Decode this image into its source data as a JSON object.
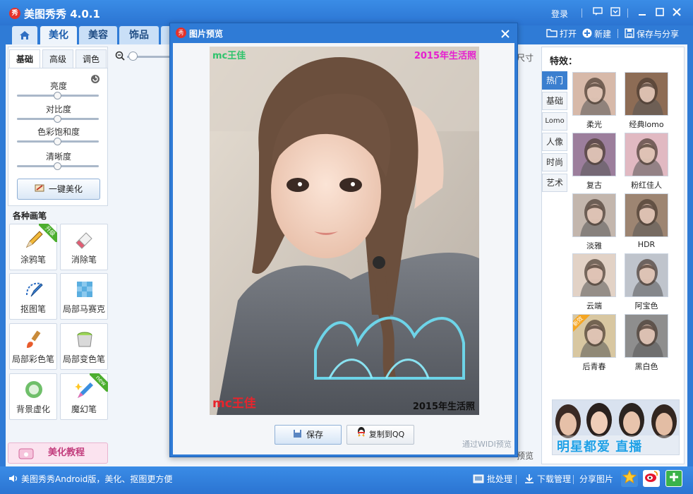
{
  "app": {
    "title": "美图秀秀 4.0.1",
    "logo_char": "秀",
    "login": "登录",
    "window_controls": [
      "chat-icon",
      "skin-icon",
      "minimize-icon",
      "maximize-icon",
      "close-icon"
    ]
  },
  "tabs": [
    {
      "label": "美化",
      "active": true
    },
    {
      "label": "美容",
      "active": false
    },
    {
      "label": "饰品",
      "active": false
    }
  ],
  "top_actions": {
    "open": "打开",
    "new": "新建",
    "save_share": "保存与分享"
  },
  "left_panel": {
    "subtabs": [
      "基础",
      "高级",
      "调色"
    ],
    "sliders": [
      {
        "label": "亮度",
        "value": 0.5
      },
      {
        "label": "对比度",
        "value": 0.5
      },
      {
        "label": "色彩饱和度",
        "value": 0.5
      },
      {
        "label": "清晰度",
        "value": 0.5
      }
    ],
    "one_click": "一键美化",
    "brushes_title": "各种画笔",
    "brushes": [
      {
        "label": "涂鸦笔",
        "badge": "升级"
      },
      {
        "label": "消除笔",
        "badge": ""
      },
      {
        "label": "抠图笔",
        "badge": ""
      },
      {
        "label": "局部马赛克",
        "badge": ""
      },
      {
        "label": "局部彩色笔",
        "badge": ""
      },
      {
        "label": "局部变色笔",
        "badge": ""
      },
      {
        "label": "背景虚化",
        "badge": ""
      },
      {
        "label": "魔幻笔",
        "badge": "new"
      }
    ],
    "tutorial": "美化教程"
  },
  "canvas": {
    "size_hint": "尺寸",
    "compare_hint": "预览"
  },
  "right_panel": {
    "title": "特效：",
    "categories": [
      {
        "label": "热门",
        "active": true
      },
      {
        "label": "基础",
        "active": false
      },
      {
        "label": "Lomo",
        "active": false
      },
      {
        "label": "人像",
        "active": false
      },
      {
        "label": "时尚",
        "active": false
      },
      {
        "label": "艺术",
        "active": false
      }
    ],
    "effects": [
      {
        "label": "柔光",
        "tint": "#d7b9a9",
        "badge": ""
      },
      {
        "label": "经典lomo",
        "tint": "#8d6c55",
        "badge": ""
      },
      {
        "label": "复古",
        "tint": "#9c7e9c",
        "badge": ""
      },
      {
        "label": "粉红佳人",
        "tint": "#e1b9c2",
        "badge": ""
      },
      {
        "label": "淡雅",
        "tint": "#c3b6ad",
        "badge": ""
      },
      {
        "label": "HDR",
        "tint": "#9d8572",
        "badge": ""
      },
      {
        "label": "云端",
        "tint": "#e2d2c6",
        "badge": ""
      },
      {
        "label": "阿宝色",
        "tint": "#bfc4cc",
        "badge": ""
      },
      {
        "label": "后青春",
        "tint": "#d8c7a1",
        "badge": "新效"
      },
      {
        "label": "黑白色",
        "tint": "#8e8e8e",
        "badge": ""
      }
    ],
    "banner_text": "明星都爱 直播"
  },
  "statusbar": {
    "promo": "美图秀秀Android版，美化、抠图更方便",
    "batch": "批处理",
    "download": "下载管理",
    "share": "分享图片"
  },
  "modal": {
    "title": "图片预览",
    "watermark_top_left": "mc王佳",
    "watermark_top_right": "2015年生活照",
    "watermark_bottom_left": "mc王佳",
    "watermark_bottom_right": "2015年生活照",
    "save": "保存",
    "copy_qq": "复制到QQ",
    "widi": "通过WIDI预览"
  },
  "colors": {
    "chrome_blue": "#2f7bd6",
    "accent_blue": "#3b7fcf",
    "watermark_green": "#2ec36b",
    "watermark_magenta": "#e61fd0",
    "watermark_red": "#e8242c",
    "watermark_black": "#111111"
  }
}
